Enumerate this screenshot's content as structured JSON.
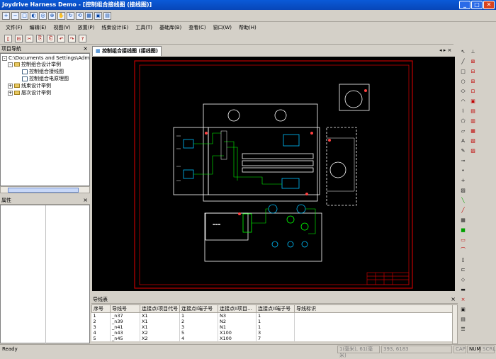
{
  "window": {
    "title": "Joydrive Harness Demo - [控制组合接线图 (接线图)]",
    "min": "_",
    "max": "□",
    "close": "✕"
  },
  "menu": [
    "文件(F)",
    "编辑(E)",
    "视图(V)",
    "放置(P)",
    "线束设计(E)",
    "工具(T)",
    "基础库(B)",
    "查看(C)",
    "窗口(W)",
    "帮助(H)"
  ],
  "nav": {
    "title": "项目导航",
    "root": "C:\\Documents and Settings\\Admin",
    "items": [
      "控制组合设计举例",
      "控制组合接线图",
      "控制组合电原理图",
      "线束设计举例",
      "层次设计举例"
    ]
  },
  "props": {
    "title": "属性"
  },
  "doc_tab": "控制组合接线图 (接线图)",
  "wire_table": {
    "title": "导线表",
    "columns": [
      "序号",
      "导线号",
      "连接点I项目代号",
      "连接点I端子号",
      "连接点II项目...",
      "连接点II端子号",
      "导线标识"
    ],
    "rows": [
      [
        "1",
        "_n37",
        "X1",
        "1",
        "N3",
        "1",
        ""
      ],
      [
        "2",
        "_n39",
        "X1",
        "2",
        "N2",
        "1",
        ""
      ],
      [
        "3",
        "_n41",
        "X1",
        "3",
        "N1",
        "1",
        ""
      ],
      [
        "4",
        "_n43",
        "X2",
        "5",
        "X100",
        "3",
        ""
      ],
      [
        "5",
        "_n45",
        "X2",
        "4",
        "X100",
        "7",
        ""
      ]
    ]
  },
  "status": {
    "ready": "Ready",
    "scale": "1(毫米), 61(毫米)",
    "coords": "393, 6183",
    "caps": "CAP",
    "num": "NUM",
    "scroll": "SCRL"
  },
  "colors": {
    "title_bar": "#0a5ad8",
    "canvas": "#000000",
    "frame": "#c00000",
    "wire": "#ffffff",
    "cyan": "#00c0ff",
    "green": "#00ff00"
  }
}
